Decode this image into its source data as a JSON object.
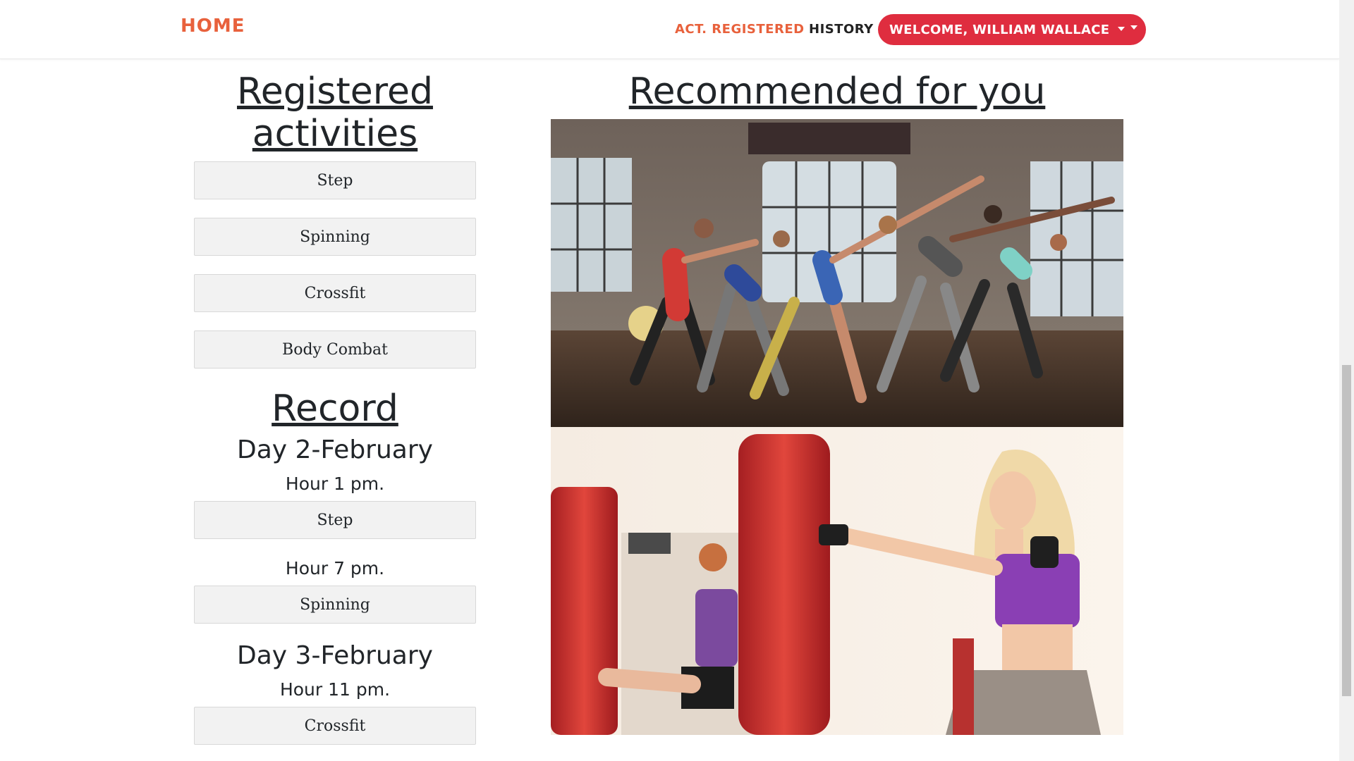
{
  "navbar": {
    "brand": "HOME",
    "links": {
      "activities_registered": "ACT. REGISTERED",
      "history": "HISTORY"
    },
    "user_menu": "WELCOME, WILLIAM WALLACE"
  },
  "registered": {
    "title_line1": "Registered",
    "title_line2": "activities",
    "activities": [
      "Step",
      "Spinning",
      "Crossfit",
      "Body Combat"
    ]
  },
  "record": {
    "title": "Record",
    "days": [
      {
        "day": "Day 2-February",
        "entries": [
          {
            "hour": "Hour 1 pm.",
            "activity": "Step"
          },
          {
            "hour": "Hour 7 pm.",
            "activity": "Spinning"
          }
        ]
      },
      {
        "day": "Day 3-February",
        "entries": [
          {
            "hour": "Hour 11 pm.",
            "activity": "Crossfit"
          }
        ]
      }
    ]
  },
  "recommended": {
    "title": "Recommended for you",
    "images": [
      "group-stretch-class-photo",
      "boxing-bag-training-photo"
    ]
  },
  "colors": {
    "accent": "#e8613c",
    "user_button": "#df2d3f",
    "button_bg": "#f2f2f2"
  }
}
